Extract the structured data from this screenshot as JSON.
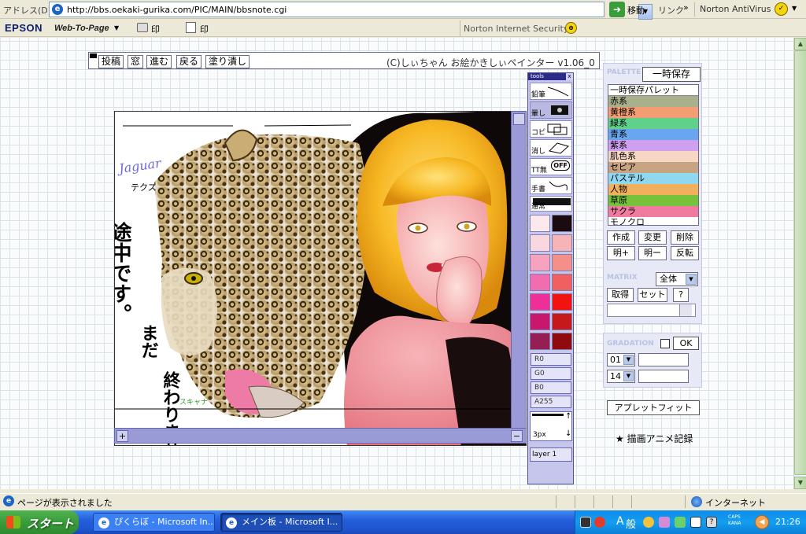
{
  "address_bar": {
    "label": "アドレス(D)",
    "url": "http://bbs.oekaki-gurika.com/PIC/MAIN/bbsnote.cgi",
    "go_label": "移動",
    "links_label": "リンク",
    "links_chevron": "»",
    "norton_label": "Norton AntiVirus"
  },
  "toolbar2": {
    "epson": "EPSON",
    "web_to_page": "Web-To-Page",
    "print_label": "印刷",
    "preview_label": "印刷プレビュー",
    "norton_security": "Norton Internet Security"
  },
  "applet": {
    "menu": [
      "投稿",
      "窓",
      "進む",
      "戻る",
      "塗り潰し"
    ],
    "credit": "(C)しぃちゃん お絵かきしぃペインター v1.06_0",
    "canvas_text": {
      "jaguar": "Jaguar",
      "tekusu": "テクス",
      "main_line": "途中です。",
      "sub1": "まだ",
      "sub2": "終わりません。",
      "signature": "スキャナ"
    }
  },
  "tools": {
    "title": "tools",
    "close": "x",
    "items": [
      "鉛筆",
      "暈し",
      "コピ",
      "消し",
      "TT無",
      "手書",
      "通常"
    ],
    "off_label": "OFF",
    "sliders": [
      "R0",
      "G0",
      "B0",
      "A255"
    ],
    "pen_size": "3px",
    "layer": "layer 1"
  },
  "palette": {
    "title": "PALETTE",
    "tmp_save": "一時保存",
    "items": [
      {
        "label": "一時保存パレット",
        "color": "#ffffff"
      },
      {
        "label": "赤系",
        "color": "#a8b08c"
      },
      {
        "label": "黄橙系",
        "color": "#f59d72"
      },
      {
        "label": "緑系",
        "color": "#5fd18a"
      },
      {
        "label": "青系",
        "color": "#6aa6f0"
      },
      {
        "label": "紫系",
        "color": "#d0a0f0"
      },
      {
        "label": "肌色系",
        "color": "#f7d7c4"
      },
      {
        "label": "セピア",
        "color": "#c8a582"
      },
      {
        "label": "パステル",
        "color": "#90d8f0"
      },
      {
        "label": "人物",
        "color": "#f2b05c"
      },
      {
        "label": "草原",
        "color": "#76c23a"
      },
      {
        "label": "サクラ",
        "color": "#f07aa0"
      },
      {
        "label": "モノクロ",
        "color": "#ffffff"
      }
    ],
    "buttons_row1": [
      "作成",
      "変更",
      "削除"
    ],
    "buttons_row2": [
      "明+",
      "明ー",
      "反転"
    ],
    "matrix_title": "MATRIX",
    "matrix_value": "全体",
    "matrix_buttons": [
      "取得",
      "セット",
      "?"
    ],
    "gradation_title": "GRADATION",
    "gradation_ok": "OK",
    "grad_sel1": "01",
    "grad_sel2": "14",
    "applet_fit": "アプレットフィット",
    "anim_record": "★ 描画アニメ記録"
  },
  "swatches": [
    [
      "#fbe9ee",
      "#1a0b0e"
    ],
    [
      "#f8d7df",
      "#f6b4b6"
    ],
    [
      "#f7a3c0",
      "#f48f8a"
    ],
    [
      "#f26db0",
      "#f06060"
    ],
    [
      "#ee2f98",
      "#f31212"
    ],
    [
      "#c8186e",
      "#c61a1a"
    ],
    [
      "#951e55",
      "#8f0b10"
    ]
  ],
  "statusbar": {
    "text": "ページが表示されました",
    "zone": "インターネット"
  },
  "taskbar": {
    "start": "スタート",
    "tasks": [
      "ぴくらぼ - Microsoft In...",
      "メイン板 - Microsoft I..."
    ],
    "ime_a": "A",
    "ime_kan": "般",
    "caps": "CAPS",
    "kana": "KANA",
    "clock": "21:26"
  }
}
